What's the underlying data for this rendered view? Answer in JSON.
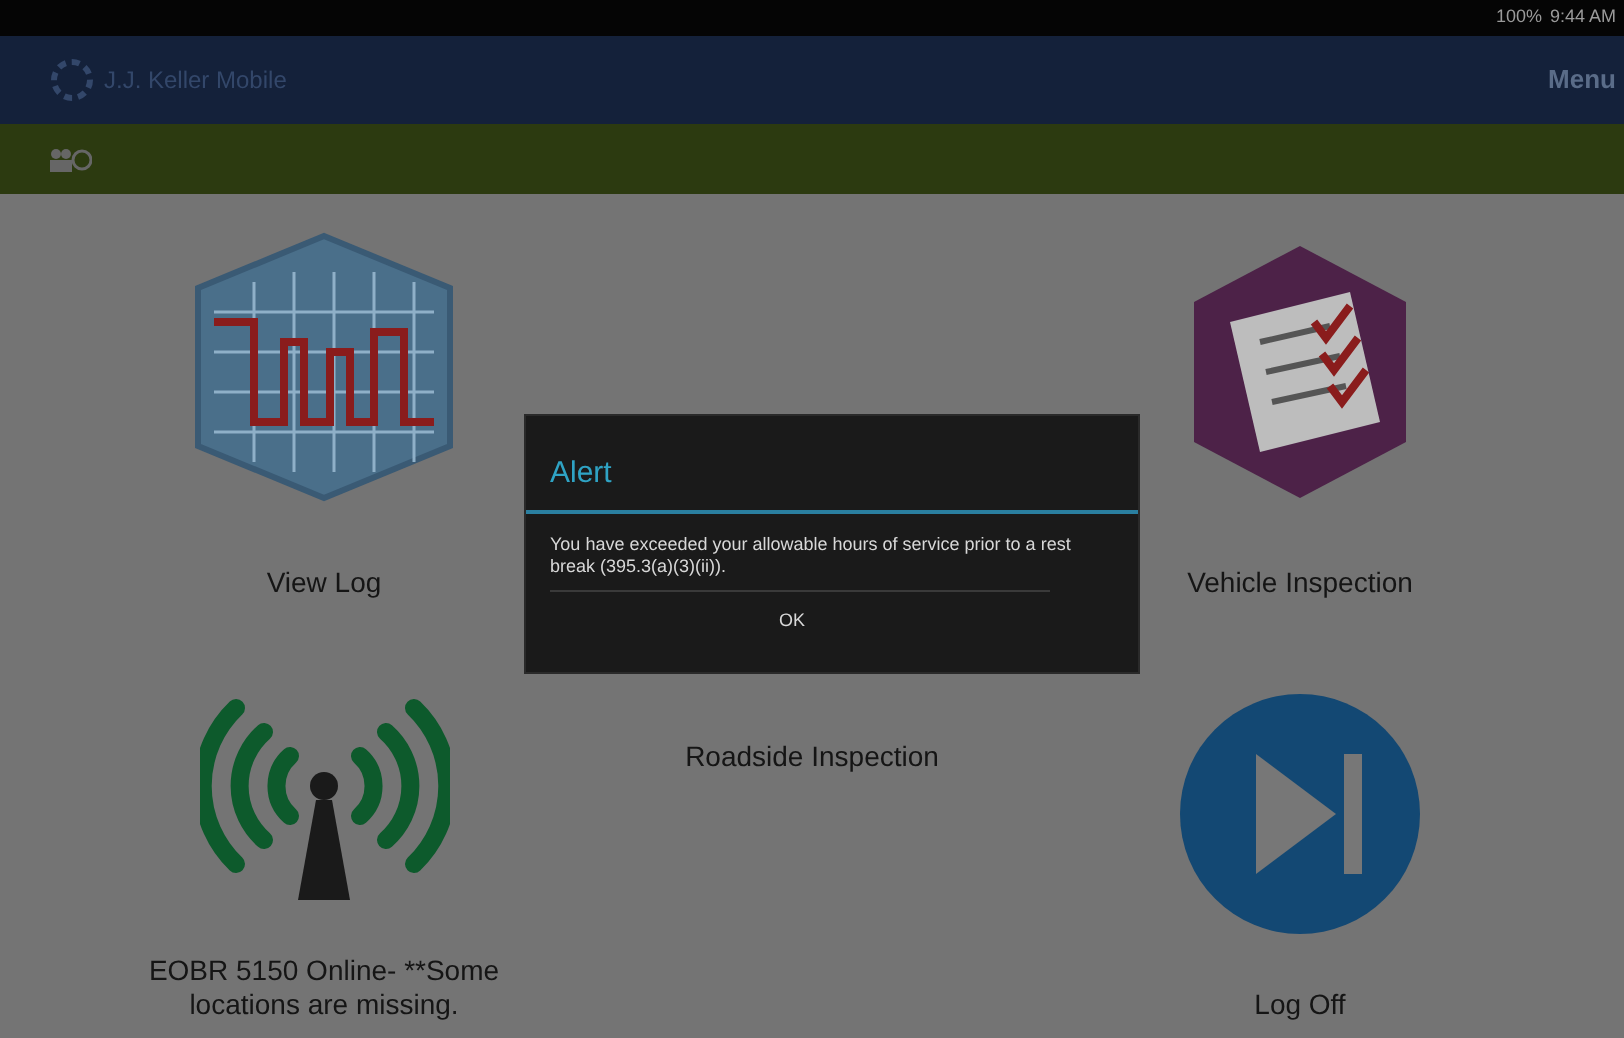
{
  "status_bar": {
    "battery": "100%",
    "time": "9:44 AM"
  },
  "app_bar": {
    "title": "J.J. Keller Mobile",
    "menu": "Menu"
  },
  "tiles": [
    {
      "kind": "log",
      "label": "View Log"
    },
    {
      "kind": "blank"
    },
    {
      "kind": "inspection",
      "label": "Vehicle Inspection"
    },
    {
      "kind": "signal",
      "label": "EOBR 5150 Online- **Some locations are missing."
    },
    {
      "kind": "roadside",
      "label": "Roadside Inspection"
    },
    {
      "kind": "logoff",
      "label": "Log Off"
    }
  ],
  "dialog": {
    "title": "Alert",
    "message": "You have exceeded your allowable hours of service prior to a rest break (395.3(a)(3)(ii)).",
    "button": "OK"
  }
}
